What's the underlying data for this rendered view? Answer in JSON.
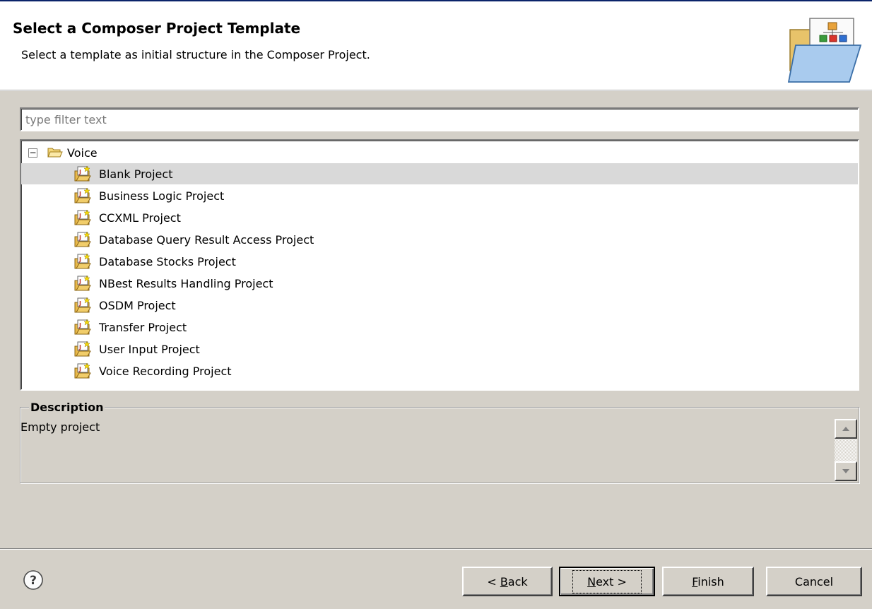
{
  "header": {
    "title": "Select a Composer Project Template",
    "subtitle": "Select a template as initial structure in the Composer Project."
  },
  "filter": {
    "placeholder": "type filter text",
    "value": ""
  },
  "tree": {
    "root": {
      "label": "Voice",
      "expanded": true,
      "toggle": "−"
    },
    "items": [
      {
        "label": "Blank Project",
        "selected": true
      },
      {
        "label": "Business Logic Project"
      },
      {
        "label": "CCXML Project"
      },
      {
        "label": "Database Query Result Access Project"
      },
      {
        "label": "Database Stocks Project"
      },
      {
        "label": "NBest Results Handling Project"
      },
      {
        "label": "OSDM Project"
      },
      {
        "label": "Transfer Project"
      },
      {
        "label": "User Input Project"
      },
      {
        "label": "Voice Recording Project"
      }
    ]
  },
  "description": {
    "label": "Description",
    "text": "Empty project"
  },
  "buttons": {
    "back": {
      "prefix": "< ",
      "mnemonic": "B",
      "rest": "ack"
    },
    "next": {
      "mnemonic": "N",
      "rest": "ext >"
    },
    "finish": {
      "mnemonic": "F",
      "rest": "inish"
    },
    "cancel": "Cancel"
  },
  "icons": {
    "help": "help-icon",
    "folder": "folder-open-icon",
    "project": "project-template-icon",
    "banner": "wizard-banner-icon"
  },
  "colors": {
    "dialog_bg": "#d4d0c8",
    "selection": "#d9d9d9",
    "title_bar_accent": "#0a246a"
  }
}
